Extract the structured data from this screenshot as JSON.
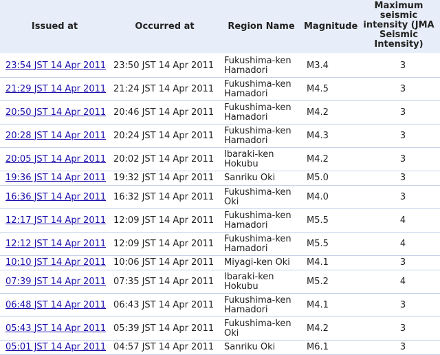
{
  "headers": {
    "issued_at": "Issued at",
    "occurred_at": "Occurred at",
    "region_name": "Region Name",
    "magnitude": "Magnitude",
    "max_intensity": "Maximum seismic intensity (JMA Seismic Intensity)"
  },
  "rows": [
    {
      "issued": "23:54 JST 14 Apr 2011",
      "occurred": "23:50 JST 14 Apr 2011",
      "region": "Fukushima-ken Hamadori",
      "magnitude": "M3.4",
      "intensity": "3"
    },
    {
      "issued": "21:29 JST 14 Apr 2011",
      "occurred": "21:24 JST 14 Apr 2011",
      "region": "Fukushima-ken Hamadori",
      "magnitude": "M4.5",
      "intensity": "3"
    },
    {
      "issued": "20:50 JST 14 Apr 2011",
      "occurred": "20:46 JST 14 Apr 2011",
      "region": "Fukushima-ken Hamadori",
      "magnitude": "M4.2",
      "intensity": "3"
    },
    {
      "issued": "20:28 JST 14 Apr 2011",
      "occurred": "20:24 JST 14 Apr 2011",
      "region": "Fukushima-ken Hamadori",
      "magnitude": "M4.3",
      "intensity": "3"
    },
    {
      "issued": "20:05 JST 14 Apr 2011",
      "occurred": "20:02 JST 14 Apr 2011",
      "region": "Ibaraki-ken Hokubu",
      "magnitude": "M4.2",
      "intensity": "3"
    },
    {
      "issued": "19:36 JST 14 Apr 2011",
      "occurred": "19:32 JST 14 Apr 2011",
      "region": "Sanriku Oki",
      "magnitude": "M5.0",
      "intensity": "3"
    },
    {
      "issued": "16:36 JST 14 Apr 2011",
      "occurred": "16:32 JST 14 Apr 2011",
      "region": "Fukushima-ken Oki",
      "magnitude": "M4.0",
      "intensity": "3"
    },
    {
      "issued": "12:17 JST 14 Apr 2011",
      "occurred": "12:09 JST 14 Apr 2011",
      "region": "Fukushima-ken Hamadori",
      "magnitude": "M5.5",
      "intensity": "4"
    },
    {
      "issued": "12:12 JST 14 Apr 2011",
      "occurred": "12:09 JST 14 Apr 2011",
      "region": "Fukushima-ken Hamadori",
      "magnitude": "M5.5",
      "intensity": "4"
    },
    {
      "issued": "10:10 JST 14 Apr 2011",
      "occurred": "10:06 JST 14 Apr 2011",
      "region": "Miyagi-ken Oki",
      "magnitude": "M4.1",
      "intensity": "3"
    },
    {
      "issued": "07:39 JST 14 Apr 2011",
      "occurred": "07:35 JST 14 Apr 2011",
      "region": "Ibaraki-ken Hokubu",
      "magnitude": "M5.2",
      "intensity": "4"
    },
    {
      "issued": "06:48 JST 14 Apr 2011",
      "occurred": "06:43 JST 14 Apr 2011",
      "region": "Fukushima-ken Hamadori",
      "magnitude": "M4.1",
      "intensity": "3"
    },
    {
      "issued": "05:43 JST 14 Apr 2011",
      "occurred": "05:39 JST 14 Apr 2011",
      "region": "Fukushima-ken Oki",
      "magnitude": "M4.2",
      "intensity": "3"
    },
    {
      "issued": "05:01 JST 14 Apr 2011",
      "occurred": "04:57 JST 14 Apr 2011",
      "region": "Sanriku Oki",
      "magnitude": "M6.1",
      "intensity": "3"
    }
  ]
}
